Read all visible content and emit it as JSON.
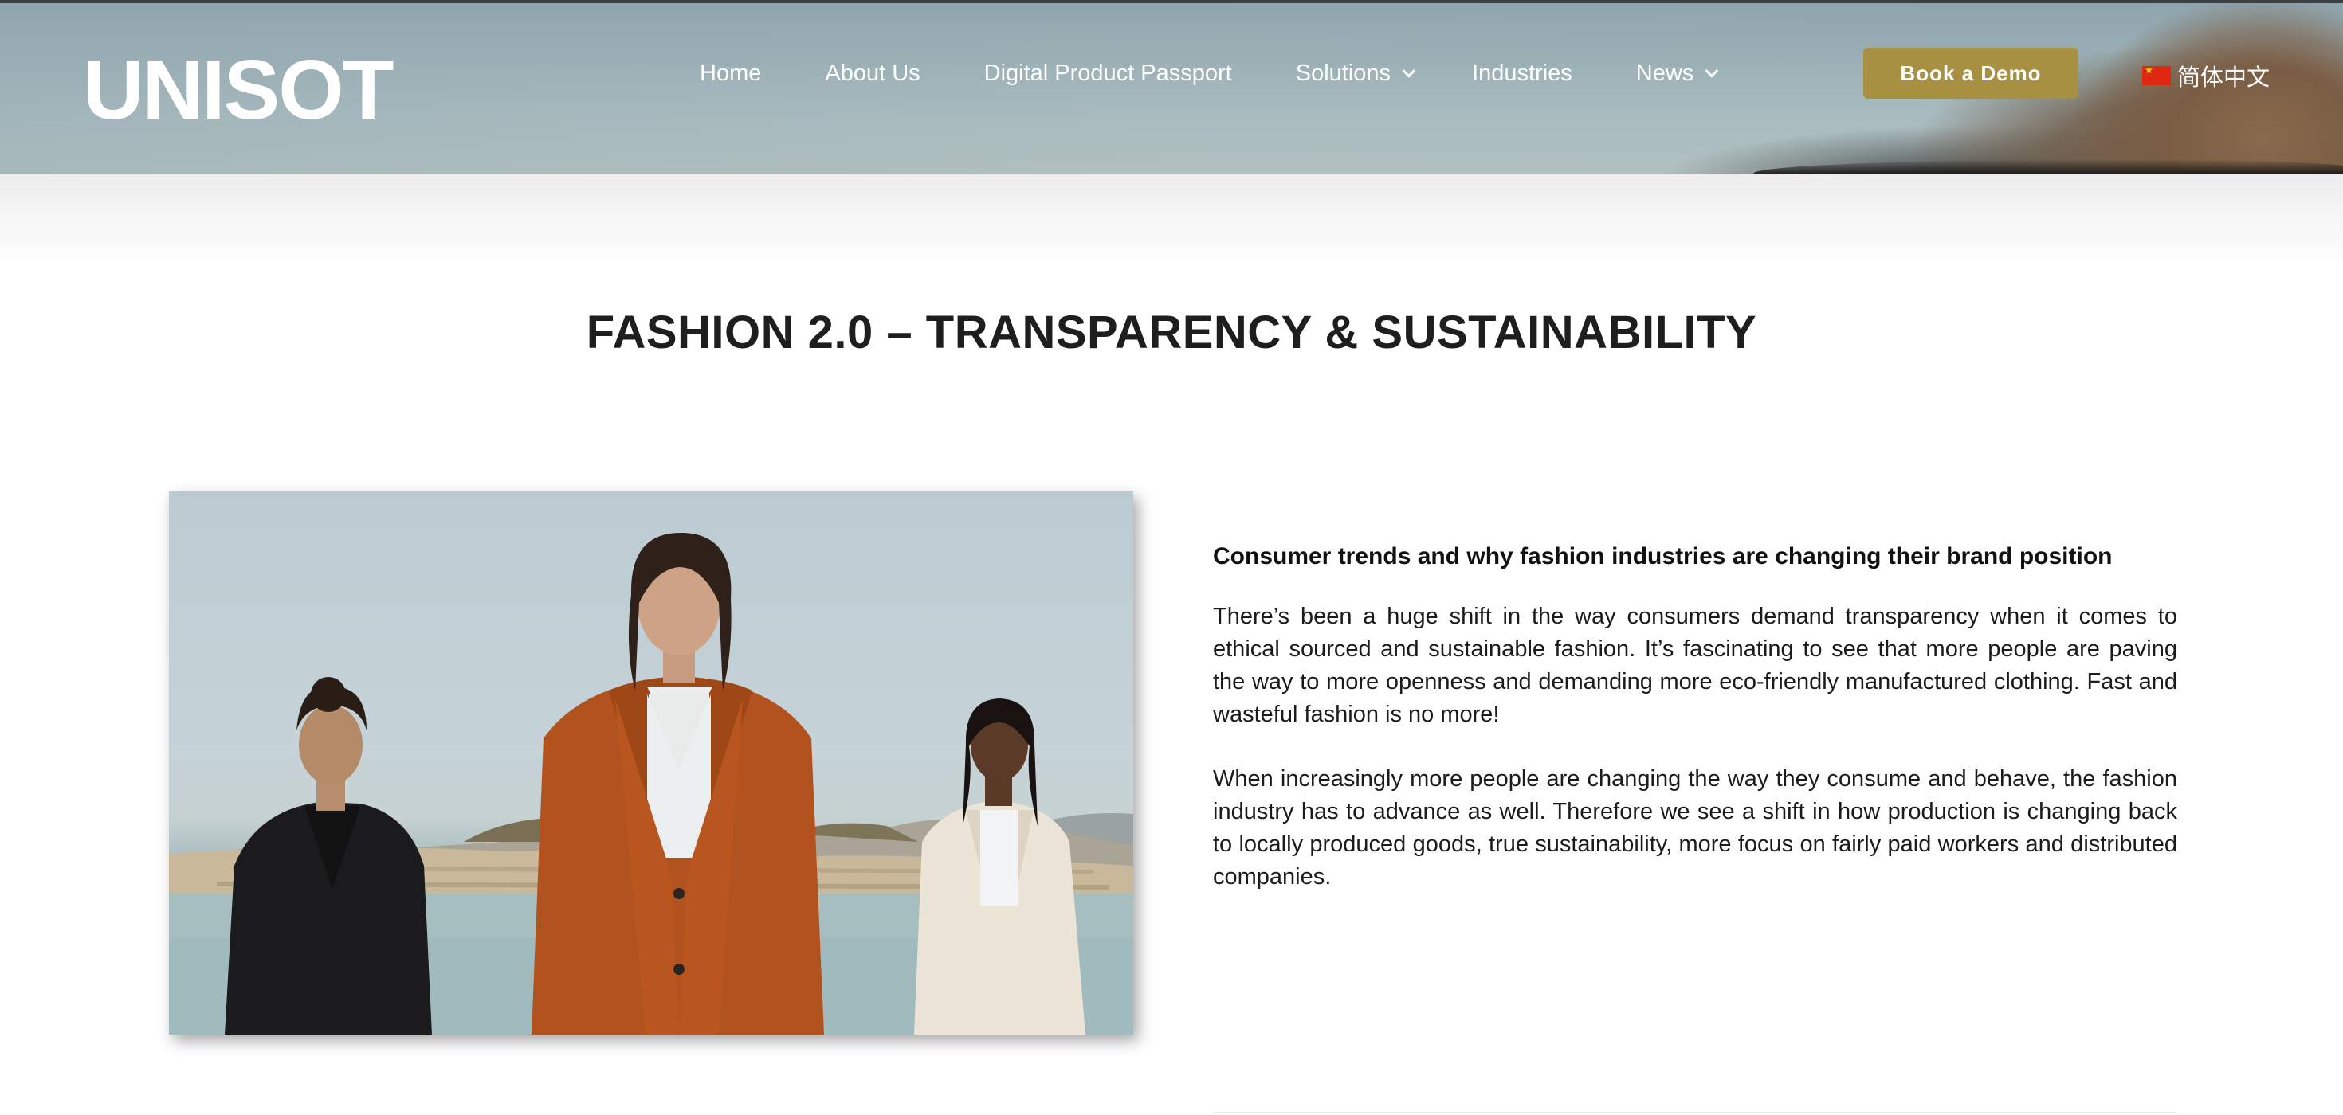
{
  "header": {
    "logo": "UNISOT",
    "nav": [
      {
        "label": "Home"
      },
      {
        "label": "About Us"
      },
      {
        "label": "Digital Product Passport"
      },
      {
        "label": "Solutions"
      },
      {
        "label": "Industries"
      },
      {
        "label": "News"
      }
    ],
    "cta_label": "Book a Demo",
    "language_label": "简体中文"
  },
  "main": {
    "title": "FASHION 2.0 – TRANSPARENCY & SUSTAINABILITY",
    "article": {
      "heading": "Consumer trends and why fashion industries are changing their brand position",
      "paragraphs": [
        "There’s been a huge shift in the way consumers demand transparency when it comes to ethical sourced and sustainable fashion. It’s fascinating to see that more people are paving the way to more openness and demanding more eco-friendly manufactured clothing. Fast and wasteful fashion is no more!",
        "When increasingly more people are changing the way they consume and behave, the fashion industry has to advance as well. Therefore we see a shift in how production is changing back to locally produced goods, true sustainability, more focus on fairly paid workers and distributed companies."
      ]
    }
  },
  "colors": {
    "accent": "#a89043",
    "text": "#1e1e1e"
  },
  "icons": {
    "dropdown": "chevron-down-icon",
    "language": "china-flag-icon"
  }
}
